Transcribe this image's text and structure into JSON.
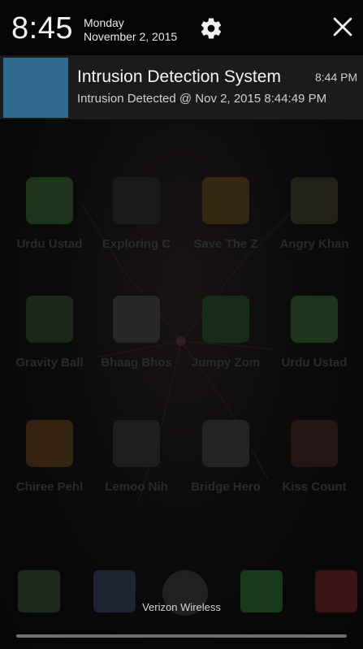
{
  "status": {
    "time": "8:45",
    "day": "Monday",
    "date": "November 2, 2015"
  },
  "icons": {
    "settings": "gear-icon",
    "close": "close-icon"
  },
  "notification": {
    "title": "Intrusion Detection System",
    "time": "8:44 PM",
    "text": "Intrusion Detected @ Nov 2, 2015 8:44:49 PM",
    "icon_color": "#316a8f"
  },
  "apps": [
    {
      "label": "Urdu Ustad",
      "color": "#1f3a1c"
    },
    {
      "label": "Exploring C",
      "color": "#1d1d1d"
    },
    {
      "label": "Save The Z",
      "color": "#3a2a14"
    },
    {
      "label": "Angry Khan",
      "color": "#25231a"
    },
    {
      "label": "Gravity Ball",
      "color": "#1c2a1c"
    },
    {
      "label": "Bhaag Bhos",
      "color": "#2a2a2a"
    },
    {
      "label": "Jumpy Zom",
      "color": "#17301a"
    },
    {
      "label": "Urdu Ustad",
      "color": "#1f3a1c"
    },
    {
      "label": "Chiree Pehl",
      "color": "#3a2612"
    },
    {
      "label": "Lemoo Nih",
      "color": "#202020"
    },
    {
      "label": "Bridge Hero",
      "color": "#262626"
    },
    {
      "label": "Kiss Count",
      "color": "#2a1616"
    }
  ],
  "carrier": "Verizon Wireless"
}
